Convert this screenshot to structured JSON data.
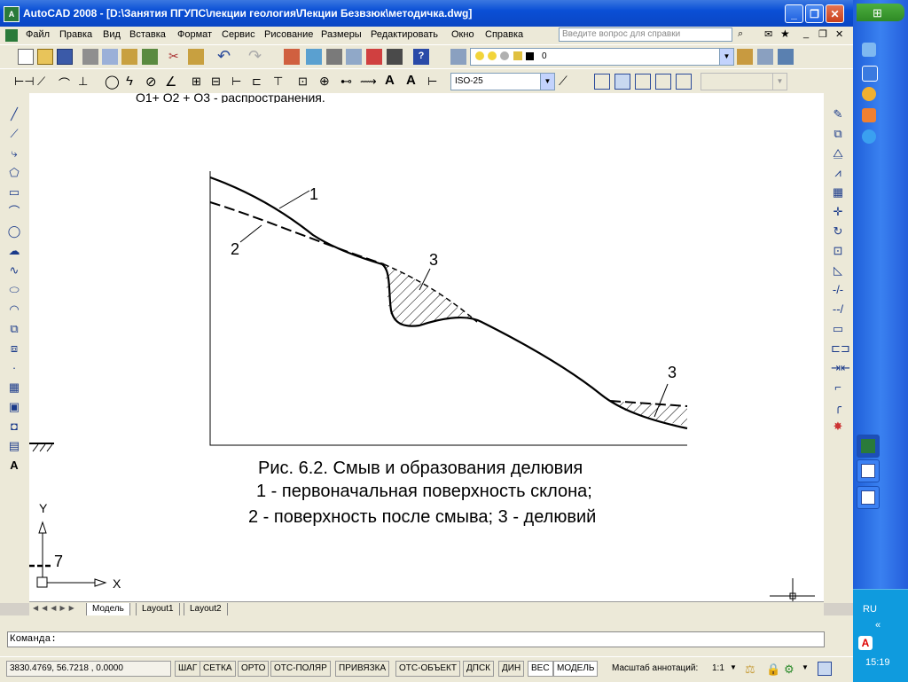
{
  "window": {
    "title": "AutoCAD 2008 - [D:\\Занятия ПГУПС\\лекции геология\\Лекции Безвзюк\\методичка.dwg]",
    "app_icon_label": "A"
  },
  "menu": {
    "items": [
      "Файл",
      "Правка",
      "Вид",
      "Вставка",
      "Формат",
      "Сервис",
      "Рисование",
      "Размеры",
      "Редактировать",
      "Окно",
      "Справка"
    ],
    "help_placeholder": "Введите вопрос для справки"
  },
  "toolbar": {
    "layer_value": "0",
    "dimstyle_value": "ISO-25"
  },
  "drawing": {
    "top_partial_text": "О1+ О2 + О3 - распространения.",
    "label_1": "1",
    "label_2": "2",
    "label_3a": "3",
    "label_3b": "3",
    "label_7": "7",
    "caption_line1": "Рис. 6.2. Смыв и образования делювия",
    "caption_line2": "1 - первоначальная поверхность склона;",
    "caption_line3": "2 - поверхность после смыва; 3 - делювий",
    "ucs_y": "Y",
    "ucs_x": "X",
    "colors": {
      "line": "#000000",
      "background": "#ffffff"
    }
  },
  "layout_tabs": [
    "Модель",
    "Layout1",
    "Layout2"
  ],
  "command": {
    "prompt": "Команда:"
  },
  "status": {
    "coords": "3830.4769, 56.7218 , 0.0000",
    "toggles": [
      "ШАГ",
      "СЕТКА",
      "ОРТО",
      "ОТС-ПОЛЯР",
      "ПРИВЯЗКА",
      "ОТС-ОБЪЕКТ",
      "ДПСК",
      "ДИН",
      "ВЕС",
      "МОДЕЛЬ"
    ],
    "annotation_scale_label": "Масштаб аннотаций:",
    "annotation_scale_value": "1:1"
  },
  "taskbar": {
    "language": "RU",
    "clock": "15:19"
  }
}
